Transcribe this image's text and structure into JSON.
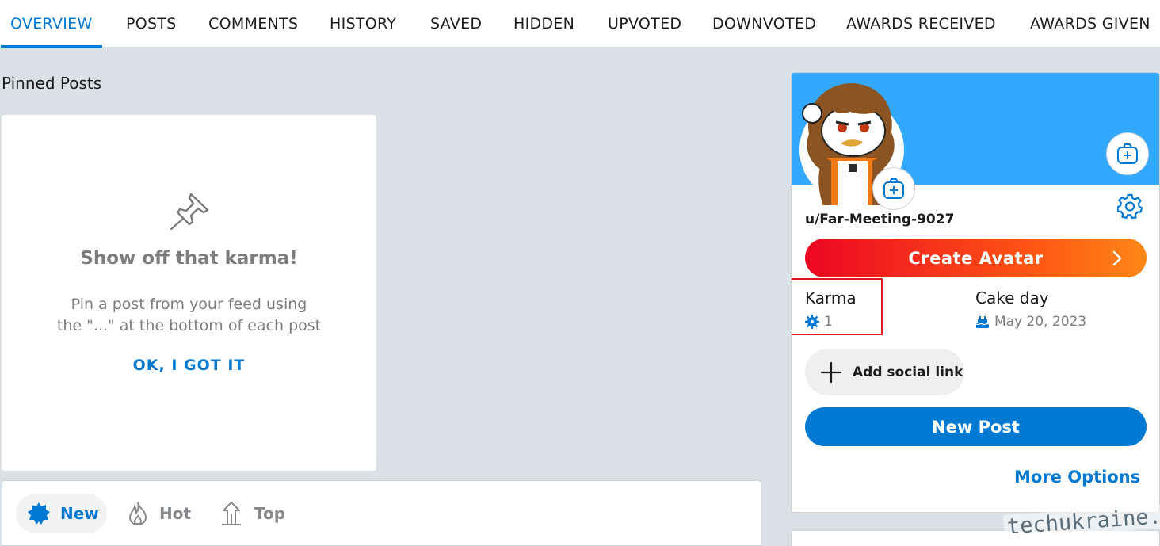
{
  "tabs": [
    {
      "label": "OVERVIEW",
      "active": true
    },
    {
      "label": "POSTS"
    },
    {
      "label": "COMMENTS"
    },
    {
      "label": "HISTORY"
    },
    {
      "label": "SAVED"
    },
    {
      "label": "HIDDEN"
    },
    {
      "label": "UPVOTED"
    },
    {
      "label": "DOWNVOTED"
    },
    {
      "label": "AWARDS RECEIVED"
    },
    {
      "label": "AWARDS GIVEN"
    }
  ],
  "pinned": {
    "title": "Pinned Posts",
    "heading": "Show off that karma!",
    "line1": "Pin a post from your feed using",
    "line2": "the \"...\" at the bottom of each post",
    "ok_label": "OK, I GOT IT"
  },
  "sort": {
    "new_label": "New",
    "hot_label": "Hot",
    "top_label": "Top"
  },
  "profile": {
    "username": "u/Far-Meeting-9027",
    "create_avatar_label": "Create Avatar",
    "karma_label": "Karma",
    "karma_value": "1",
    "cake_label": "Cake day",
    "cake_value": "May 20, 2023",
    "social_label": "Add social link",
    "new_post_label": "New Post",
    "more_options_label": "More Options"
  },
  "watermark": "techukraine.net",
  "colors": {
    "accent": "#0079d3",
    "banner": "#33a8ff",
    "page_bg": "#dae0e6",
    "highlight": "#e21b23"
  }
}
